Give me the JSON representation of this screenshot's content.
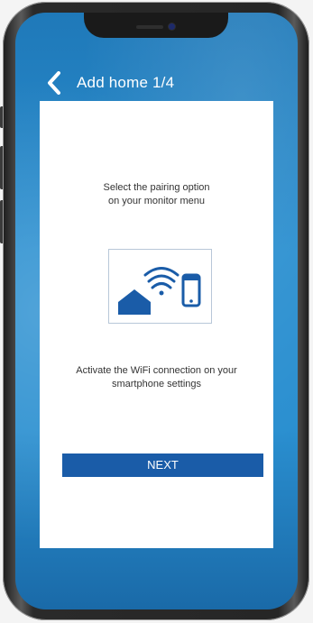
{
  "header": {
    "title": "Add home 1/4",
    "back_icon": "chevron-left-icon"
  },
  "content": {
    "instruction_1": "Select the pairing option\non your monitor menu",
    "instruction_2": "Activate the WiFi connection on your\nsmartphone settings",
    "illustration_icons": [
      "house-icon",
      "wifi-icon",
      "smartphone-icon"
    ]
  },
  "actions": {
    "next_label": "NEXT"
  },
  "colors": {
    "screen_background": "#2a8fd0",
    "button": "#1a5ca8",
    "icon": "#1a5ca8",
    "card": "#ffffff"
  }
}
